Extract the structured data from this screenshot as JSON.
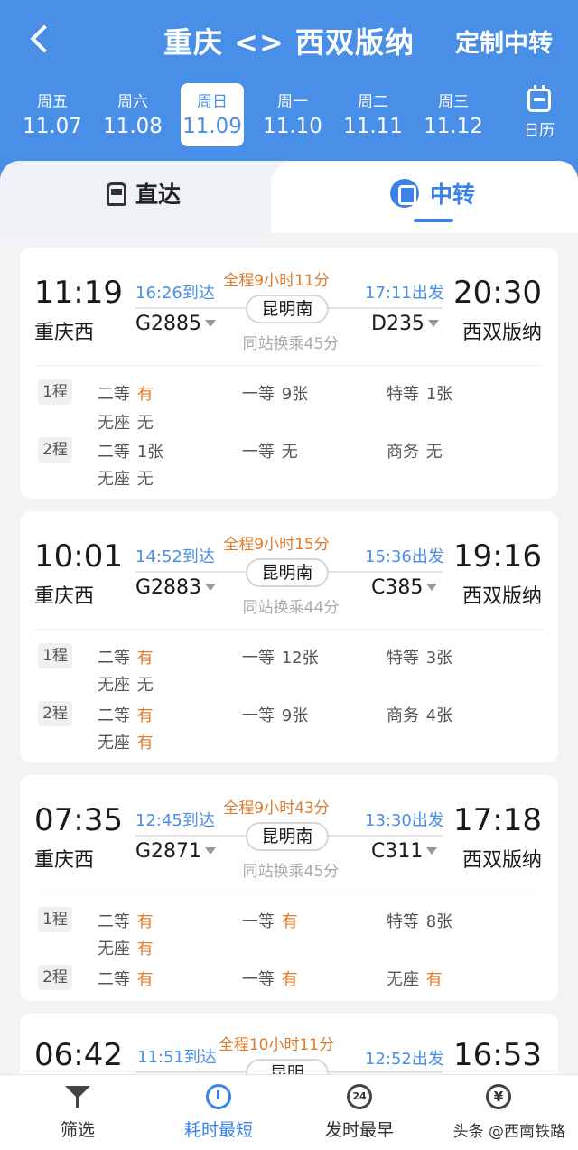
{
  "header": {
    "title": "重庆 <> 西双版纳",
    "custom_transfer": "定制中转"
  },
  "dates": [
    {
      "dow": "周五",
      "date": "11.07"
    },
    {
      "dow": "周六",
      "date": "11.08"
    },
    {
      "dow": "周日",
      "date": "11.09",
      "active": true
    },
    {
      "dow": "周一",
      "date": "11.10"
    },
    {
      "dow": "周二",
      "date": "11.11"
    },
    {
      "dow": "周三",
      "date": "11.12"
    }
  ],
  "calendar_label": "日历",
  "tabs": {
    "direct": "直达",
    "transfer": "中转"
  },
  "cards": [
    {
      "dep_time": "11:19",
      "dep_station": "重庆西",
      "arr_time": "20:30",
      "arr_station": "西双版纳",
      "leg1_arrive": "16:26到达",
      "leg2_depart": "17:11出发",
      "train1": "G2885",
      "train2": "D235",
      "total": "全程9小时11分",
      "station": "昆明南",
      "xfer": "同站换乘45分",
      "legs": [
        {
          "label": "1程",
          "seats": [
            {
              "name": "二等",
              "value": "有",
              "orange": true
            },
            {
              "name": "一等",
              "value": "9张"
            },
            {
              "name": "特等",
              "value": "1张"
            },
            {
              "name": "无座",
              "value": "无"
            }
          ]
        },
        {
          "label": "2程",
          "seats": [
            {
              "name": "二等",
              "value": "1张"
            },
            {
              "name": "一等",
              "value": "无"
            },
            {
              "name": "商务",
              "value": "无"
            },
            {
              "name": "无座",
              "value": "无"
            }
          ]
        }
      ]
    },
    {
      "dep_time": "10:01",
      "dep_station": "重庆西",
      "arr_time": "19:16",
      "arr_station": "西双版纳",
      "leg1_arrive": "14:52到达",
      "leg2_depart": "15:36出发",
      "train1": "G2883",
      "train2": "C385",
      "total": "全程9小时15分",
      "station": "昆明南",
      "xfer": "同站换乘44分",
      "legs": [
        {
          "label": "1程",
          "seats": [
            {
              "name": "二等",
              "value": "有",
              "orange": true
            },
            {
              "name": "一等",
              "value": "12张"
            },
            {
              "name": "特等",
              "value": "3张"
            },
            {
              "name": "无座",
              "value": "无"
            }
          ]
        },
        {
          "label": "2程",
          "seats": [
            {
              "name": "二等",
              "value": "有",
              "orange": true
            },
            {
              "name": "一等",
              "value": "9张"
            },
            {
              "name": "商务",
              "value": "4张"
            },
            {
              "name": "无座",
              "value": "有",
              "orange": true
            }
          ]
        }
      ]
    },
    {
      "dep_time": "07:35",
      "dep_station": "重庆西",
      "arr_time": "17:18",
      "arr_station": "西双版纳",
      "leg1_arrive": "12:45到达",
      "leg2_depart": "13:30出发",
      "train1": "G2871",
      "train2": "C311",
      "total": "全程9小时43分",
      "station": "昆明南",
      "xfer": "同站换乘45分",
      "legs": [
        {
          "label": "1程",
          "seats": [
            {
              "name": "二等",
              "value": "有",
              "orange": true
            },
            {
              "name": "一等",
              "value": "有",
              "orange": true
            },
            {
              "name": "特等",
              "value": "8张"
            },
            {
              "name": "无座",
              "value": "有",
              "orange": true
            }
          ]
        },
        {
          "label": "2程",
          "seats": [
            {
              "name": "二等",
              "value": "有",
              "orange": true
            },
            {
              "name": "一等",
              "value": "有",
              "orange": true
            },
            {
              "name": "无座",
              "value": "有",
              "orange": true
            }
          ]
        }
      ]
    },
    {
      "dep_time": "06:42",
      "arr_time": "16:53",
      "leg1_arrive": "11:51到达",
      "leg2_depart": "12:52出发",
      "total": "全程10小时11分",
      "station": "昆明"
    }
  ],
  "tabbar": {
    "filter": "筛选",
    "fastest": "耗时最短",
    "earliest": "发时最早",
    "cheapest_icon_glyph": "¥",
    "earliest_icon_glyph": "24"
  },
  "watermark": "头条 @西南铁路",
  "colors": {
    "primary": "#4a8fe7",
    "accent_orange": "#e07b2a"
  }
}
